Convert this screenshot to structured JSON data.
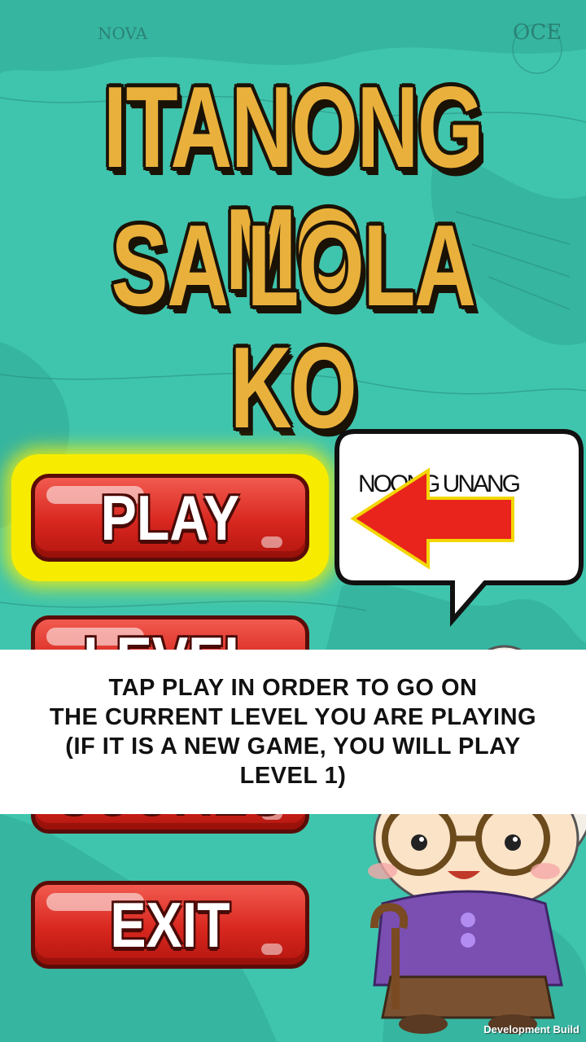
{
  "title": {
    "line1": "ITANONG MO",
    "line2": "SA LOLA KO"
  },
  "menu": {
    "play_label": "PLAY",
    "level_label": "LEVEL",
    "scores_label": "SCORES",
    "exit_label": "EXIT"
  },
  "speech_bubble": {
    "text": "NOONG UNANG"
  },
  "tutorial": {
    "lines": [
      "TAP PLAY IN ORDER TO GO ON",
      "THE CURRENT LEVEL YOU ARE PLAYING",
      "(IF IT IS A NEW GAME, YOU WILL PLAY",
      "LEVEL 1)"
    ]
  },
  "footer": {
    "build_label": "Development Build"
  },
  "colors": {
    "background": "#3ec4ac",
    "title": "#e9b13c",
    "button": "#d8271f",
    "highlight": "#f7ec00",
    "arrow": "#e8241c"
  }
}
